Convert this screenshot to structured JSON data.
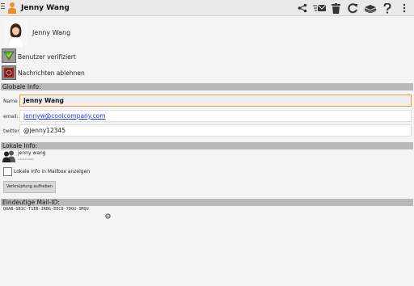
{
  "header": {
    "title": "Jenny Wang",
    "actions": [
      "share-icon",
      "mail-icon",
      "trash-icon",
      "refresh-icon",
      "books-icon",
      "help-icon",
      "overflow-menu-icon"
    ]
  },
  "contact": {
    "name": "Jenny Wang"
  },
  "options": {
    "verified_label": "Benutzer verifiziert",
    "block_label": "Nachrichten ablehnen"
  },
  "global_info": {
    "section_title": "Globale Info:",
    "name_label": "Name",
    "name_value": "Jenny Wang",
    "email_label": "email:",
    "email_value": "jennyw@coolcompany.com",
    "twitter_label": "twitter",
    "twitter_value": "@jenny12345"
  },
  "local_info": {
    "section_title": "Lokale Info:",
    "name": "jenny wang",
    "subtitle": "Lokale Kontakte",
    "mailbox_checkbox_label": "Lokale Info in Mailbox anzeigen",
    "unlink_button": "Verknüpfung aufheben"
  },
  "mail_id": {
    "section_title": "Eindeutige Mail-ID:",
    "value": "Q0AB-SB1C-T1EB-JRBG-EEC8-7DGU-3MQU"
  },
  "colors": {
    "focus_border": "#e89a3c",
    "section_bg": "#b9b9b9",
    "link": "#1a3fd6"
  }
}
